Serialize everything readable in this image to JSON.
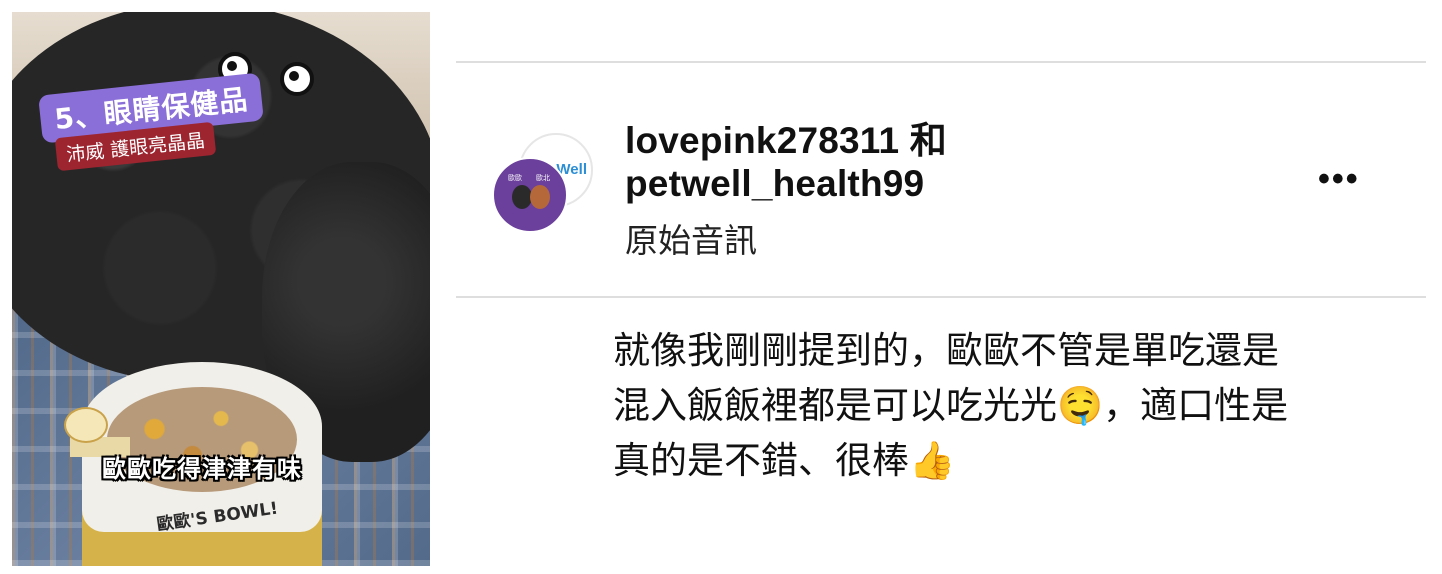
{
  "media": {
    "title_badge": "5、眼睛保健品",
    "subtitle_badge": "沛威 護眼亮晶晶",
    "caption": "歐歐吃得津津有味",
    "bowl_text": "歐歐'S BOWL!"
  },
  "post": {
    "users_line1": "lovepink278311 和",
    "users_line2": "petwell_health99",
    "audio": "原始音訊",
    "avatar_logo": "Well",
    "avatar_labels": [
      "歐歐",
      "歐北"
    ],
    "more": "•••",
    "comment_lines": [
      "就像我剛剛提到的，歐歐不管是單吃還是",
      "混入飯飯裡都是可以吃光光🤤，適口性是",
      "真的是不錯、很棒👍"
    ]
  },
  "colors": {
    "title_badge_bg": "#8b6fd8",
    "subtitle_badge_bg": "#9c2530",
    "avatar_bg": "#6b3f9c",
    "divider": "#dedede"
  }
}
